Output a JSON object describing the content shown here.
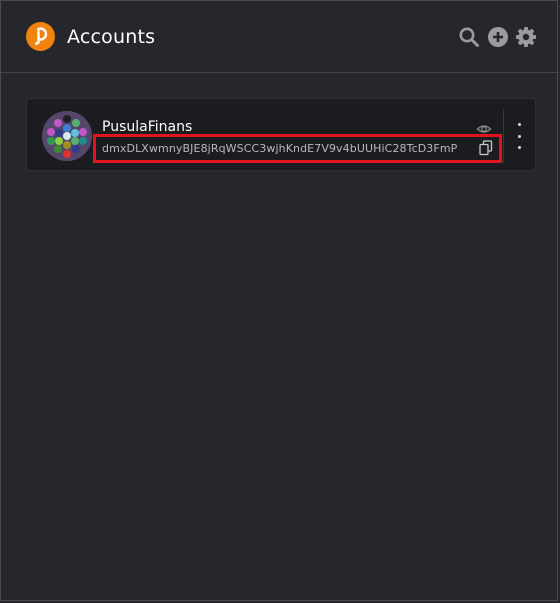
{
  "header": {
    "title": "Accounts",
    "icons": [
      "polkadot-logo-icon",
      "search-icon",
      "add-account-icon",
      "settings-gear-icon"
    ]
  },
  "account": {
    "name": "PusulaFinans",
    "address": "dmxDLXwmnyBJE8jRqWSCC3wjhKndE7V9v4bUUHiC28TcD3FmP",
    "icons": [
      "identicon-avatar",
      "eye-icon",
      "copy-icon",
      "more-options-icon"
    ]
  },
  "colors": {
    "background": "#26272c",
    "card": "#1b1c20",
    "accent": "#f1830f",
    "highlight": "#e3131d"
  }
}
